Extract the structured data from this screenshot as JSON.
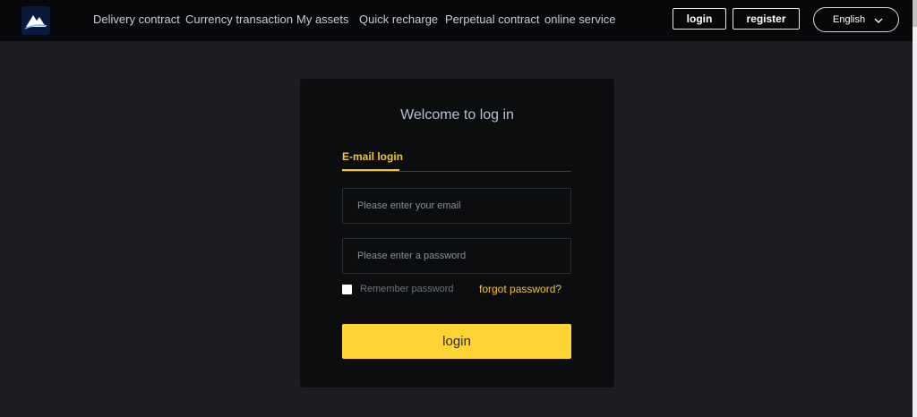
{
  "header": {
    "logo_icon": "mountain-logo-icon",
    "nav": [
      {
        "label": "Delivery contract"
      },
      {
        "label": "Currency transaction"
      },
      {
        "label": "My assets"
      },
      {
        "label": "Quick recharge"
      },
      {
        "label": "Perpetual contract"
      },
      {
        "label": "online service"
      }
    ],
    "login_label": "login",
    "register_label": "register",
    "language": "English"
  },
  "login_panel": {
    "title": "Welcome to log in",
    "tab_label": "E-mail login",
    "email_placeholder": "Please enter your email",
    "password_placeholder": "Please enter a password",
    "remember_label": "Remember password",
    "remember_checked": false,
    "forgot_label": "forgot password?",
    "submit_label": "login"
  },
  "colors": {
    "accent": "#fcd535",
    "link": "#f3c62a",
    "background": "#1c1d21",
    "panel": "#0c0d0f",
    "topbar": "#070809"
  }
}
